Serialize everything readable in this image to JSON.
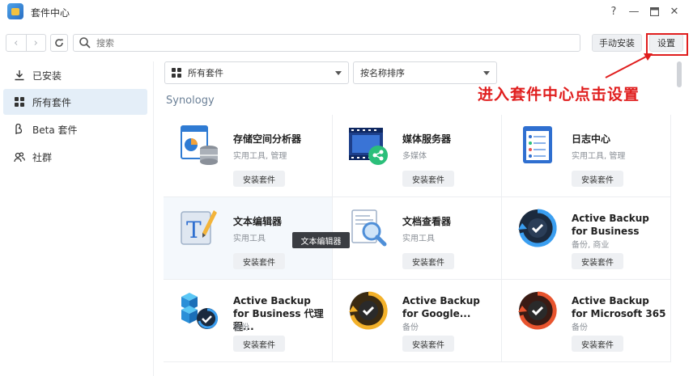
{
  "window": {
    "title": "套件中心",
    "controls": {
      "help": "?",
      "minimize": "—",
      "maximize": "□",
      "close": "✕"
    }
  },
  "toolbar": {
    "search_placeholder": "搜索",
    "manual_install": "手动安装",
    "settings": "设置"
  },
  "sidebar": {
    "items": [
      {
        "label": "已安装",
        "icon": "download-icon"
      },
      {
        "label": "所有套件",
        "icon": "grid-icon"
      },
      {
        "label": "Beta 套件",
        "icon": "beta-icon"
      },
      {
        "label": "社群",
        "icon": "community-icon"
      }
    ]
  },
  "filters": {
    "category": "所有套件",
    "sort": "按名称排序"
  },
  "section": "Synology",
  "annotation": "进入套件中心点击设置",
  "packages": [
    {
      "name": "存储空间分析器",
      "category": "实用工具, 管理",
      "install": "安装套件"
    },
    {
      "name": "媒体服务器",
      "category": "多媒体",
      "install": "安装套件"
    },
    {
      "name": "日志中心",
      "category": "实用工具, 管理",
      "install": "安装套件"
    },
    {
      "name": "文本编辑器",
      "category": "实用工具",
      "install": "安装套件"
    },
    {
      "name": "文档查看器",
      "category": "实用工具",
      "install": "安装套件"
    },
    {
      "name": "Active Backup for Business",
      "category": "备份, 商业",
      "install": "安装套件"
    },
    {
      "name": "Active Backup for Business 代理程...",
      "category": "备份",
      "install": "安装套件"
    },
    {
      "name": "Active Backup for Google...",
      "category": "备份",
      "install": "安装套件"
    },
    {
      "name": "Active Backup for Microsoft 365",
      "category": "备份",
      "install": "安装套件"
    }
  ],
  "tooltip": "文本编辑器",
  "colors": {
    "annotation_red": "#e01e1e",
    "active_bg": "#e4eef8",
    "section_label": "#6b8097"
  }
}
